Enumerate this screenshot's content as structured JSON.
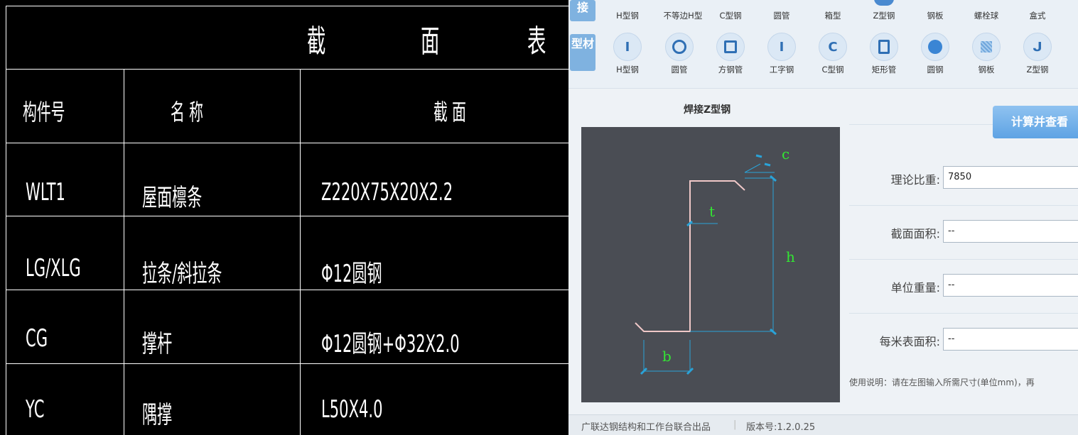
{
  "cad_table": {
    "title_chars": [
      "截",
      "面",
      "表"
    ],
    "headers": {
      "member_no": "构件号",
      "name": "名  称",
      "section": "截  面"
    },
    "rows": [
      {
        "member_no": "WLT1",
        "name": "屋面檩条",
        "section": "Z220X75X20X2.2"
      },
      {
        "member_no": "LG/XLG",
        "name": "拉条/斜拉条",
        "section": "Φ12圆钢"
      },
      {
        "member_no": "CG",
        "name": "撑杆",
        "section": "Φ12圆钢+Φ32X2.0"
      },
      {
        "member_no": "YC",
        "name": "隅撑",
        "section": "L50X4.0"
      }
    ]
  },
  "tool_panel": {
    "weld_category_label": "接",
    "weld_items": [
      "H型钢",
      "不等边H型",
      "C型钢",
      "圆管",
      "箱型",
      "Z型钢",
      "钢板",
      "螺栓球",
      "盒式"
    ],
    "profile_category_label": "型材",
    "profile_items": [
      {
        "label": "H型钢",
        "icon": "i-beam-icon"
      },
      {
        "label": "圆管",
        "icon": "round-pipe-icon"
      },
      {
        "label": "方钢管",
        "icon": "square-pipe-icon"
      },
      {
        "label": "工字钢",
        "icon": "i-section-icon"
      },
      {
        "label": "C型钢",
        "icon": "c-channel-icon"
      },
      {
        "label": "矩形管",
        "icon": "rect-pipe-icon"
      },
      {
        "label": "圆钢",
        "icon": "round-bar-icon"
      },
      {
        "label": "钢板",
        "icon": "steel-plate-icon"
      },
      {
        "label": "Z型钢",
        "icon": "z-section-icon"
      }
    ],
    "diagram_title": "焊接Z型钢",
    "diagram_labels": {
      "c": "c",
      "t": "t",
      "h": "h",
      "b": "b"
    },
    "calc_button": "计算并查看",
    "fields": [
      {
        "label": "理论比重:",
        "value": "7850"
      },
      {
        "label": "截面面积:",
        "value": "--"
      },
      {
        "label": "单位重量:",
        "value": "--"
      },
      {
        "label": "每米表面积:",
        "value": "--"
      }
    ],
    "usage_note": "使用说明：请在左图输入所需尺寸(单位mm)，再",
    "footer_left": "广联达钢结构和工作台联合出品",
    "footer_version": "版本号:1.2.0.25",
    "colors": {
      "accent": "#5ea3e4",
      "diagram_bg": "#4a4d54",
      "dim_line": "#2aa3d8",
      "dim_text": "#33e633"
    }
  }
}
